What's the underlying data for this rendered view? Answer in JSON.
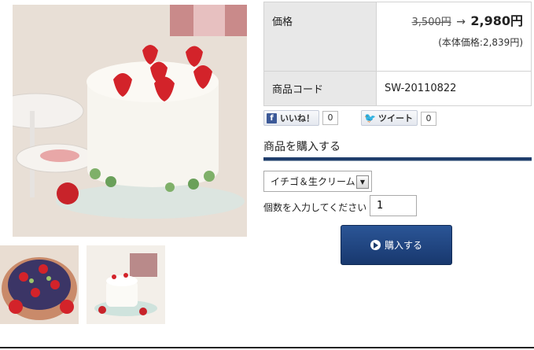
{
  "product": {
    "main_image": "strawberry-shortcake-photo",
    "thumbnails": [
      "berry-tart-photo",
      "white-cake-photo"
    ]
  },
  "info": {
    "price_label": "価格",
    "old_price": "3,500円",
    "arrow": "→",
    "new_price": "2,980円",
    "tax_note": "(本体価格:2,839円)",
    "code_label": "商品コード",
    "code_value": "SW-20110822"
  },
  "social": {
    "like_label": "いいね！",
    "like_count": "0",
    "tweet_label": "ツイート",
    "tweet_count": "0"
  },
  "purchase": {
    "section_title": "商品を購入する",
    "variant_selected": "イチゴ＆生クリーム",
    "quantity_label": "個数を入力してください",
    "quantity_value": "1",
    "buy_label": "購入する"
  },
  "colors": {
    "accent": "#1f3d6c",
    "facebook": "#3b5998",
    "twitter": "#33aaee"
  }
}
